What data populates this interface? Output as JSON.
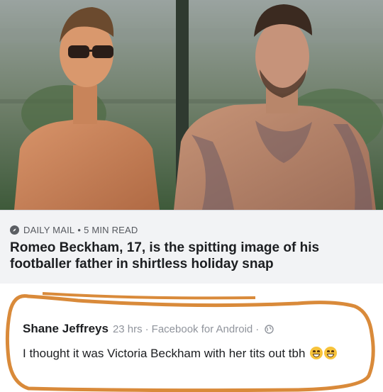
{
  "article": {
    "source": "DAILY MAIL",
    "read_time": "5 MIN READ",
    "headline": "Romeo Beckham, 17, is the spitting image of his footballer father in shirtless holiday snap"
  },
  "comment": {
    "author": "Shane Jeffreys",
    "time": "23 hrs",
    "via": "Facebook for Android",
    "text": "I thought it was Victoria Beckham with her tits out tbh"
  },
  "colors": {
    "highlight_outline": "#d98a3a",
    "card_bg": "#f2f3f5"
  },
  "icons": [
    "compass-icon",
    "globe-icon",
    "laughing-emoji-icon"
  ]
}
